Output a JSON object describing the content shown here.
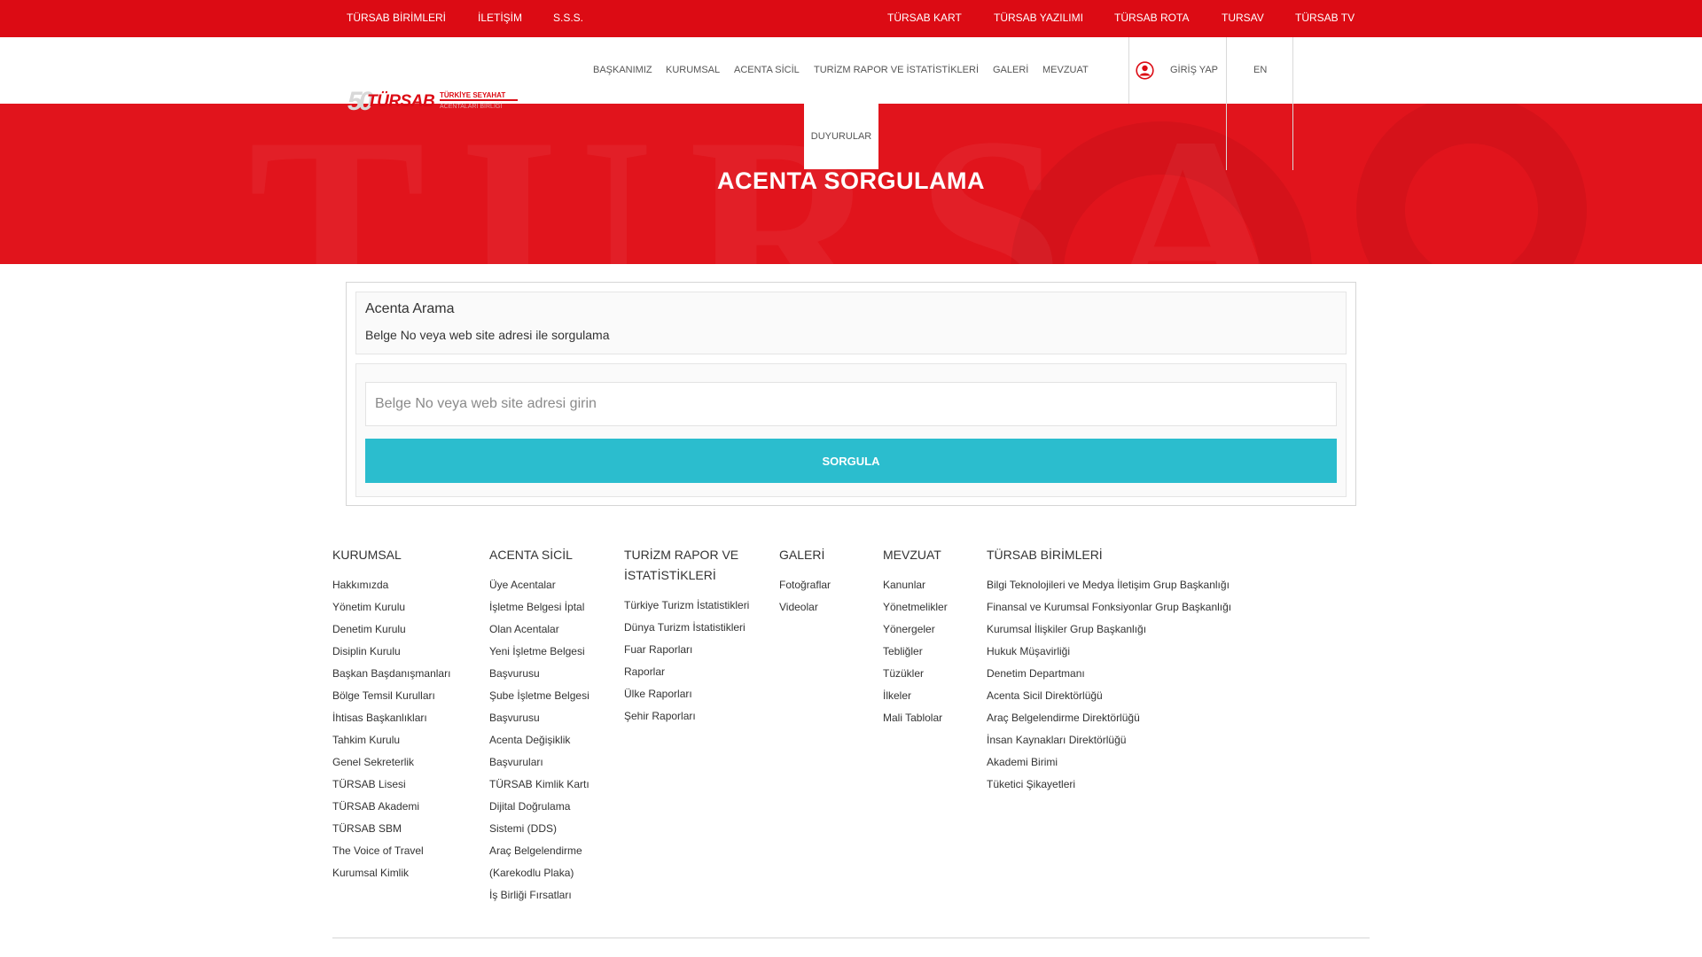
{
  "topbar": {
    "left": [
      "TÜRSAB BİRİMLERİ",
      "İLETİŞİM",
      "S.S.S."
    ],
    "right": [
      "TÜRSAB KART",
      "TÜRSAB YAZILIMI",
      "TÜRSAB ROTA",
      "TURSAV",
      "TÜRSAB TV"
    ]
  },
  "logo": {
    "fifty": "50",
    "brand": "TÜRSAB",
    "tag": "TÜRKİYE SEYAHAT",
    "tagsub": "ACENTALARI BİRLİĞİ"
  },
  "nav": {
    "items": [
      "BAŞKANIMIZ",
      "KURUMSAL",
      "ACENTA SİCİL",
      "TURİZM RAPOR VE İSTATİSTİKLERİ",
      "GALERİ",
      "MEVZUAT"
    ],
    "dropdown": "DUYURULAR",
    "login": "GİRİŞ YAP",
    "lang": "EN"
  },
  "hero": {
    "title": "ACENTA SORGULAMA"
  },
  "search": {
    "heading": "Acenta Arama",
    "description": "Belge No veya web site adresi ile sorgulama",
    "placeholder": "Belge No veya web site adresi girin",
    "button": "SORGULA"
  },
  "footer": {
    "kurumsal": {
      "title": "KURUMSAL",
      "links": [
        "Hakkımızda",
        "Yönetim Kurulu",
        "Denetim Kurulu",
        "Disiplin Kurulu",
        "Başkan Başdanışmanları",
        "Bölge Temsil Kurulları",
        "İhtisas Başkanlıkları",
        "Tahkim Kurulu",
        "Genel Sekreterlik",
        "TÜRSAB Lisesi",
        "TÜRSAB Akademi",
        "TÜRSAB SBM",
        "The Voice of Travel",
        "Kurumsal Kimlik"
      ]
    },
    "acenta": {
      "title": "ACENTA SİCİL",
      "links": [
        "Üye Acentalar",
        "İşletme Belgesi İptal",
        "Olan Acentalar",
        "Yeni İşletme Belgesi",
        "Başvurusu",
        "Şube İşletme Belgesi",
        "Başvurusu",
        "Acenta Değişiklik",
        "Başvuruları",
        "TÜRSAB Kimlik Kartı",
        "Dijital Doğrulama",
        "Sistemi (DDS)",
        "Araç Belgelendirme",
        "(Karekodlu Plaka)",
        "İş Birliği Fırsatları"
      ]
    },
    "turizm": {
      "title_line1": "TURİZM RAPOR VE",
      "title_line2": "İSTATİSTİKLERİ",
      "links": [
        "Türkiye Turizm İstatistikleri",
        "Dünya Turizm İstatistikleri",
        "Fuar Raporları",
        "Raporlar",
        "Ülke Raporları",
        "Şehir Raporları"
      ]
    },
    "galeri": {
      "title": "GALERİ",
      "links": [
        "Fotoğraflar",
        "Videolar"
      ]
    },
    "mevzuat": {
      "title": "MEVZUAT",
      "links": [
        "Kanunlar",
        "Yönetmelikler",
        "Yönergeler",
        "Tebliğler",
        "Tüzükler",
        "İlkeler",
        "Mali Tablolar"
      ]
    },
    "birimler": {
      "title": "TÜRSAB BİRİMLERİ",
      "links": [
        "Bilgi Teknolojileri ve Medya İletişim Grup Başkanlığı",
        "Finansal ve Kurumsal Fonksiyonlar Grup Başkanlığı",
        "Kurumsal İlişkiler Grup Başkanlığı",
        "Hukuk Müşavirliği",
        "Denetim Departmanı",
        "Acenta Sicil Direktörlüğü",
        "Araç Belgelendirme Direktörlüğü",
        "İnsan Kaynakları Direktörlüğü",
        "Akademi Birimi",
        "Tüketici Şikayetleri"
      ]
    }
  },
  "colors": {
    "brand_red": "#dc0b14",
    "hero_red": "#e1141c",
    "button_teal": "#2bbdce"
  }
}
